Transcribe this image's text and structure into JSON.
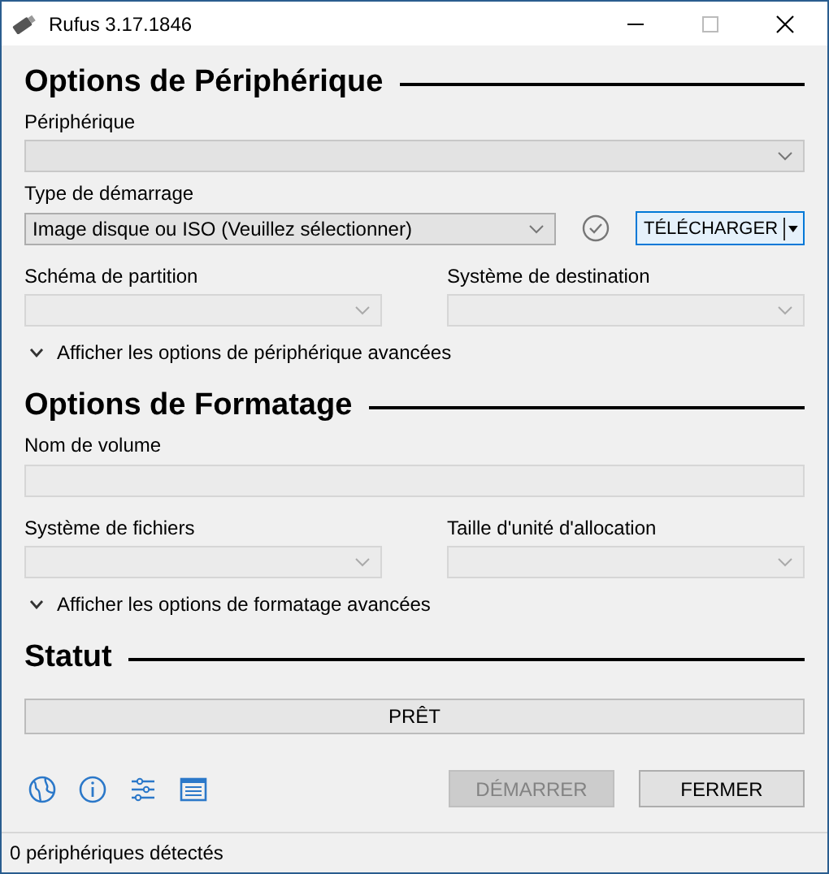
{
  "window": {
    "title": "Rufus 3.17.1846"
  },
  "device_options": {
    "heading": "Options de Périphérique",
    "device": {
      "label": "Périphérique"
    },
    "boot_type": {
      "label": "Type de démarrage",
      "value": "Image disque ou ISO (Veuillez sélectionner)"
    },
    "download_button": {
      "label": "TÉLÉCHARGER"
    },
    "partition_scheme": {
      "label": "Schéma de partition"
    },
    "target_system": {
      "label": "Système de destination"
    },
    "advanced_toggle": {
      "label": "Afficher les options de périphérique avancées",
      "expanded": false
    }
  },
  "format_options": {
    "heading": "Options de Formatage",
    "volume_name": {
      "label": "Nom de volume"
    },
    "file_system": {
      "label": "Système de fichiers"
    },
    "cluster_size": {
      "label": "Taille d'unité d'allocation"
    },
    "advanced_toggle": {
      "label": "Afficher les options de formatage avancées",
      "expanded": false
    }
  },
  "status": {
    "heading": "Statut",
    "progress": {
      "text": "PRÊT"
    }
  },
  "buttons": [
    {
      "label": "DÉMARRER",
      "disabled": true
    },
    {
      "label": "FERMER",
      "disabled": false
    }
  ],
  "status_bar": {
    "text": "0 périphériques détectés"
  }
}
